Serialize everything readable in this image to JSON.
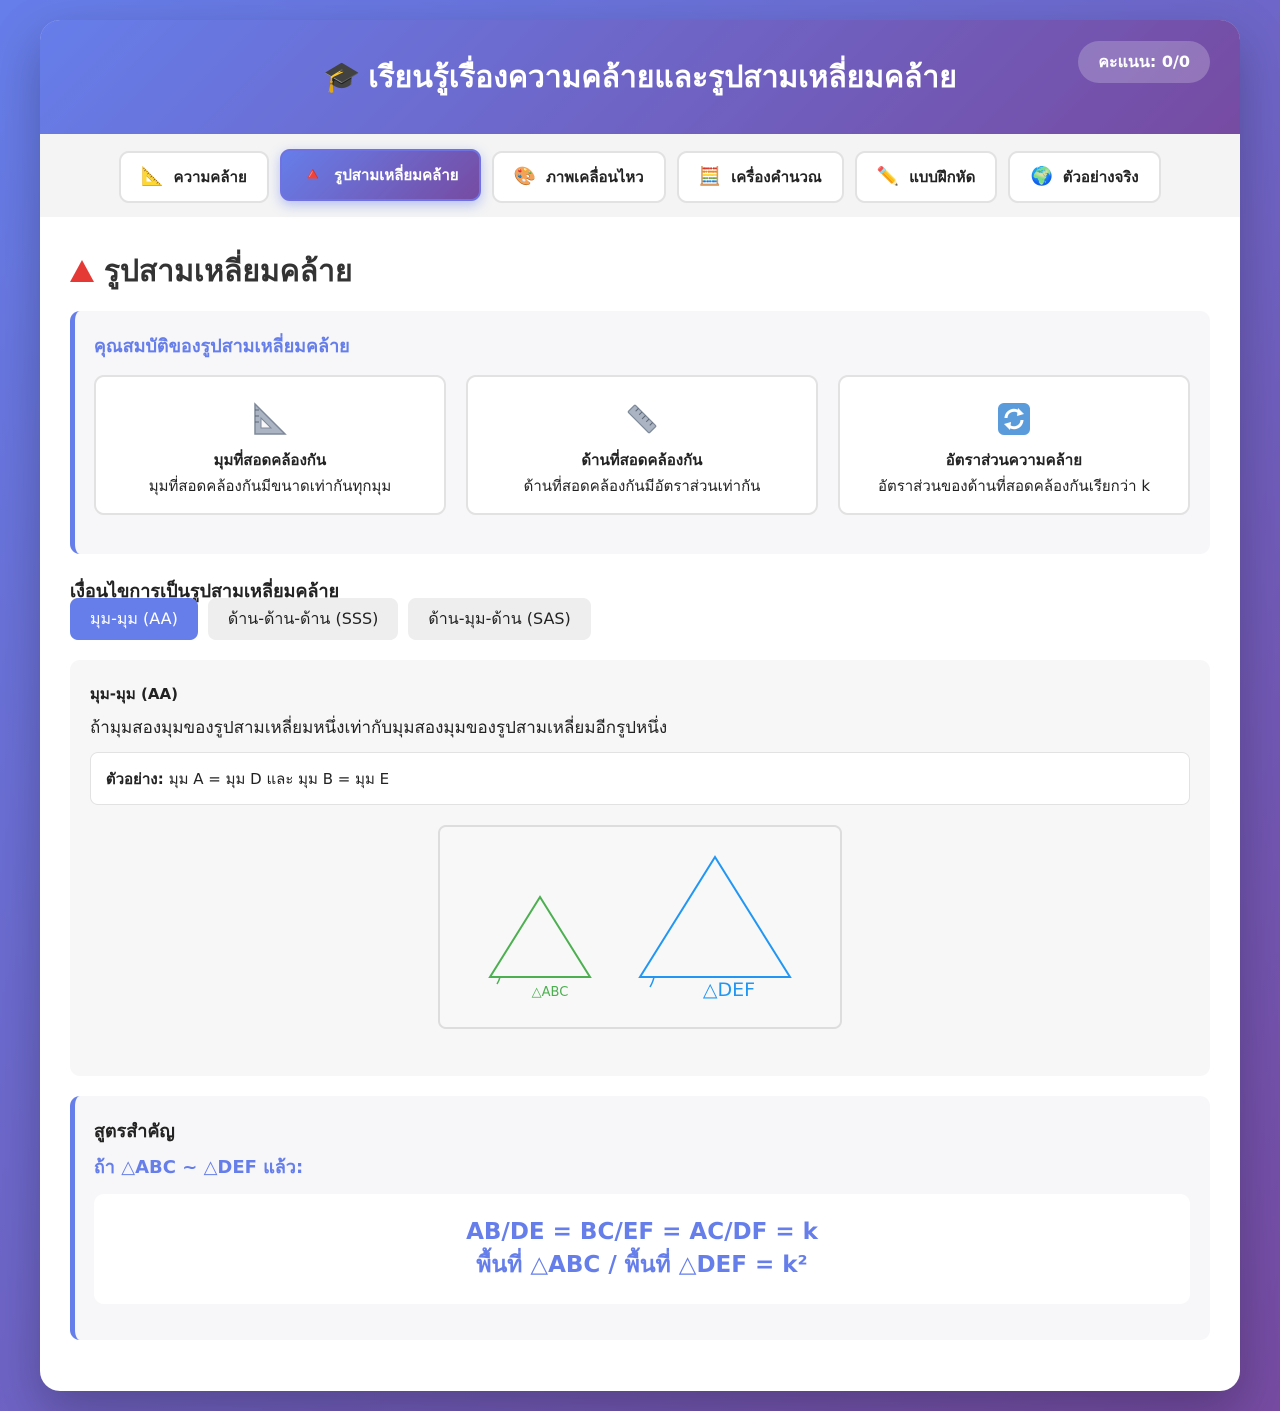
{
  "header": {
    "icon": "🎓",
    "title": "เรียนรู้เรื่องความคล้ายและรูปสามเหลี่ยมคล้าย",
    "score": "คะแนน: 0/0"
  },
  "tabs": [
    {
      "icon": "📐",
      "label": "ความคล้าย",
      "active": false
    },
    {
      "icon": "🔺",
      "label": "รูปสามเหลี่ยมคล้าย",
      "active": true
    },
    {
      "icon": "🎨",
      "label": "ภาพเคลื่อนไหว",
      "active": false
    },
    {
      "icon": "🧮",
      "label": "เครื่องคำนวณ",
      "active": false
    },
    {
      "icon": "✏️",
      "label": "แบบฝึกหัด",
      "active": false
    },
    {
      "icon": "🌍",
      "label": "ตัวอย่างจริง",
      "active": false
    }
  ],
  "page": {
    "title": "รูปสามเหลี่ยมคล้าย"
  },
  "properties": {
    "title": "คุณสมบัติของรูปสามเหลี่ยมคล้าย",
    "cards": [
      {
        "icon": "triangle-ruler-icon",
        "title": "มุมที่สอดคล้องกัน",
        "desc": "มุมที่สอดคล้องกันมีขนาดเท่ากันทุกมุม"
      },
      {
        "icon": "straight-ruler-icon",
        "title": "ด้านที่สอดคล้องกัน",
        "desc": "ด้านที่สอดคล้องกันมีอัตราส่วนเท่ากัน"
      },
      {
        "icon": "repeat-arrows-icon",
        "title": "อัตราส่วนความคล้าย",
        "desc": "อัตราส่วนของด้านที่สอดคล้องกันเรียกว่า k"
      }
    ]
  },
  "conditions": {
    "title": "เงื่อนไขการเป็นรูปสามเหลี่ยมคล้าย",
    "tabs": [
      "มุม-มุม (AA)",
      "ด้าน-ด้าน-ด้าน (SSS)",
      "ด้าน-มุม-ด้าน (SAS)"
    ],
    "active": {
      "title": "มุม-มุม (AA)",
      "desc": "ถ้ามุมสองมุมของรูปสามเหลี่ยมหนึ่งเท่ากับมุมสองมุมของรูปสามเหลี่ยมอีกรูปหนึ่ง",
      "example_label": "ตัวอย่าง:",
      "example_text": "มุม A = มุม D และ มุม B = มุม E",
      "diagram": {
        "small_label": "△ABC",
        "large_label": "△DEF",
        "small_color": "#4caf50",
        "large_color": "#2196f3"
      }
    }
  },
  "formula": {
    "title": "สูตรสำคัญ",
    "subtitle": "ถ้า △ABC ~ △DEF แล้ว:",
    "line1": "AB/DE = BC/EF = AC/DF = k",
    "line2": "พื้นที่ △ABC / พื้นที่ △DEF = k²"
  },
  "colors": {
    "accent": "#667eea",
    "gradient_end": "#764ba2"
  }
}
